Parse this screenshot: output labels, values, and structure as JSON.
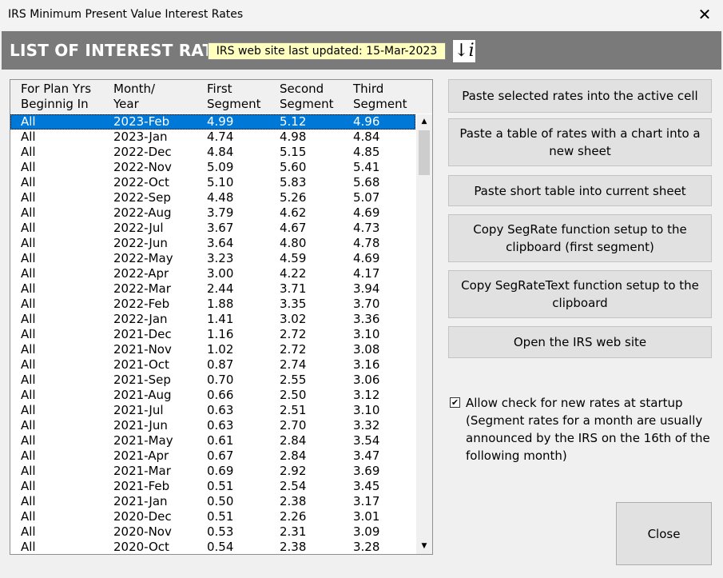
{
  "window": {
    "title": "IRS Minimum Present Value Interest Rates",
    "close_glyph": "✕"
  },
  "banner": {
    "heading": "LIST OF INTEREST RATES",
    "updated_text": "IRS web site last updated: 15-Mar-2023",
    "info_glyph": "↓i"
  },
  "table": {
    "headers": [
      [
        "For Plan Yrs",
        "Beginnig In"
      ],
      [
        "Month/",
        "Year"
      ],
      [
        "First",
        "Segment"
      ],
      [
        "Second",
        "Segment"
      ],
      [
        "Third",
        "Segment"
      ]
    ],
    "rows": [
      [
        "All",
        "2023-Feb",
        "4.99",
        "5.12",
        "4.96"
      ],
      [
        "All",
        "2023-Jan",
        "4.74",
        "4.98",
        "4.84"
      ],
      [
        "All",
        "2022-Dec",
        "4.84",
        "5.15",
        "4.85"
      ],
      [
        "All",
        "2022-Nov",
        "5.09",
        "5.60",
        "5.41"
      ],
      [
        "All",
        "2022-Oct",
        "5.10",
        "5.83",
        "5.68"
      ],
      [
        "All",
        "2022-Sep",
        "4.48",
        "5.26",
        "5.07"
      ],
      [
        "All",
        "2022-Aug",
        "3.79",
        "4.62",
        "4.69"
      ],
      [
        "All",
        "2022-Jul",
        "3.67",
        "4.67",
        "4.73"
      ],
      [
        "All",
        "2022-Jun",
        "3.64",
        "4.80",
        "4.78"
      ],
      [
        "All",
        "2022-May",
        "3.23",
        "4.59",
        "4.69"
      ],
      [
        "All",
        "2022-Apr",
        "3.00",
        "4.22",
        "4.17"
      ],
      [
        "All",
        "2022-Mar",
        "2.44",
        "3.71",
        "3.94"
      ],
      [
        "All",
        "2022-Feb",
        "1.88",
        "3.35",
        "3.70"
      ],
      [
        "All",
        "2022-Jan",
        "1.41",
        "3.02",
        "3.36"
      ],
      [
        "All",
        "2021-Dec",
        "1.16",
        "2.72",
        "3.10"
      ],
      [
        "All",
        "2021-Nov",
        "1.02",
        "2.72",
        "3.08"
      ],
      [
        "All",
        "2021-Oct",
        "0.87",
        "2.74",
        "3.16"
      ],
      [
        "All",
        "2021-Sep",
        "0.70",
        "2.55",
        "3.06"
      ],
      [
        "All",
        "2021-Aug",
        "0.66",
        "2.50",
        "3.12"
      ],
      [
        "All",
        "2021-Jul",
        "0.63",
        "2.51",
        "3.10"
      ],
      [
        "All",
        "2021-Jun",
        "0.63",
        "2.70",
        "3.32"
      ],
      [
        "All",
        "2021-May",
        "0.61",
        "2.84",
        "3.54"
      ],
      [
        "All",
        "2021-Apr",
        "0.67",
        "2.84",
        "3.47"
      ],
      [
        "All",
        "2021-Mar",
        "0.69",
        "2.92",
        "3.69"
      ],
      [
        "All",
        "2021-Feb",
        "0.51",
        "2.54",
        "3.45"
      ],
      [
        "All",
        "2021-Jan",
        "0.50",
        "2.38",
        "3.17"
      ],
      [
        "All",
        "2020-Dec",
        "0.51",
        "2.26",
        "3.01"
      ],
      [
        "All",
        "2020-Nov",
        "0.53",
        "2.31",
        "3.09"
      ],
      [
        "All",
        "2020-Oct",
        "0.54",
        "2.38",
        "3.28"
      ]
    ],
    "scroll_up_glyph": "▲",
    "scroll_down_glyph": "▼"
  },
  "buttons": {
    "paste_selected": "Paste selected rates into the active cell",
    "paste_table_chart": "Paste a table of rates with a chart into a new sheet",
    "paste_short": "Paste short table into current sheet",
    "copy_segrate": "Copy SegRate function setup to the clipboard (first segment)",
    "copy_segratetext": "Copy SegRateText function setup to the clipboard",
    "open_irs": "Open the IRS web site",
    "close": "Close"
  },
  "options": {
    "check_glyph": "✔",
    "allow_check_label": "Allow check for new rates at startup (Segment rates for a month are usually announced by the IRS on the 16th of the following month)"
  }
}
